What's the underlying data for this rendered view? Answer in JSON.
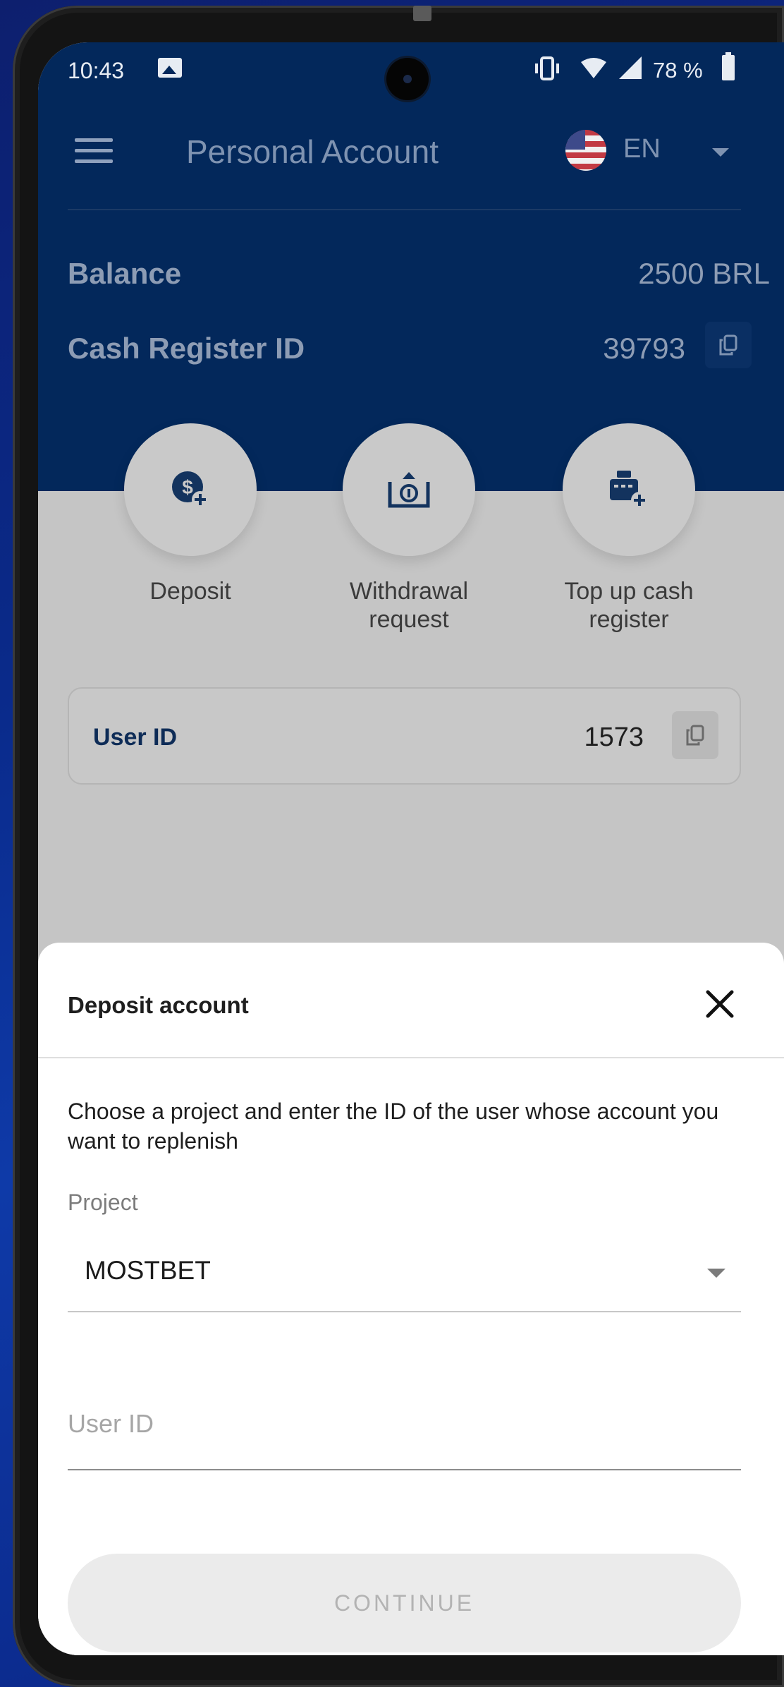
{
  "status_bar": {
    "time": "10:43",
    "battery": "78 %",
    "icons": [
      "gallery-icon",
      "vibrate-icon",
      "wifi-icon",
      "signal-icon",
      "battery-icon"
    ]
  },
  "header": {
    "title": "Personal Account",
    "language": "EN",
    "flag": "us-flag-icon",
    "menu_icon": "menu-icon"
  },
  "account": {
    "balance_label": "Balance",
    "balance_value": "2500 BRL",
    "register_label": "Cash Register ID",
    "register_value": "39793"
  },
  "actions": [
    {
      "label": "Deposit",
      "icon": "dollar-plus-icon"
    },
    {
      "label": "Withdrawal request",
      "icon": "withdraw-icon"
    },
    {
      "label": "Top up cash register",
      "icon": "register-plus-icon"
    }
  ],
  "user_card": {
    "label": "User ID",
    "value": "1573"
  },
  "sheet": {
    "title": "Deposit account",
    "description": "Choose a project and enter the ID of the user whose account you want to replenish",
    "project_label": "Project",
    "project_value": "MOSTBET",
    "user_id_placeholder": "User ID",
    "user_id_value": "",
    "continue_label": "CONTINUE"
  },
  "colors": {
    "header_bg": "#03285b",
    "overlay_bg": "#c5c5c5",
    "accent_dark": "#0e2c57",
    "disabled_button": "#ebebeb"
  }
}
